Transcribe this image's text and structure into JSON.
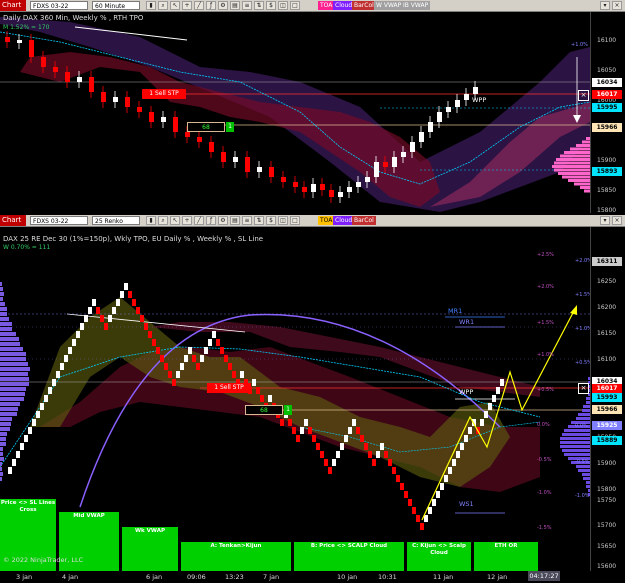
{
  "top_toolbar": {
    "chart_label": "Chart",
    "instrument": "FDXS 03-22",
    "interval": "60 Minute",
    "tags": [
      "TOA",
      "Cloud",
      "BarCol",
      "W VWAP",
      "IB VWAP"
    ]
  },
  "top_pane": {
    "title": "Daily DAX 360 Min, Weekly % , RTH TPO",
    "subtitle": "M 1.52% = 170",
    "price_ticks": [
      "16100",
      "16050",
      "16000",
      "15950",
      "15900",
      "15850",
      "15800"
    ],
    "pct_label": "+1.0%",
    "flags": [
      {
        "text": "16034",
        "bg": "#ffffff",
        "fg": "#000000"
      },
      {
        "text": "16017",
        "bg": "#ff0000",
        "fg": "#ffffff"
      },
      {
        "text": "15995",
        "bg": "#00e5ff",
        "fg": "#000000"
      },
      {
        "text": "15966",
        "bg": "#ffe4b5",
        "fg": "#000000"
      },
      {
        "text": "15893",
        "bg": "#00e5ff",
        "fg": "#000000"
      }
    ],
    "sell_stp": "1 Sell STP",
    "box_value": "68",
    "box_count": "1",
    "wpp": "WPP"
  },
  "bottom_toolbar": {
    "chart_label": "Chart",
    "instrument": "FDXS 03-22",
    "interval": "25 Renko",
    "tags": [
      "TOA",
      "Cloud",
      "BarCol"
    ]
  },
  "bottom_pane": {
    "title": "DAX 25 RE Dec 30 (1%=150p), Wkly TPO, EU Daily % , Weekly % , SL Line",
    "subtitle": "W 0.70% = 111",
    "price_ticks": [
      "16311",
      "16250",
      "16200",
      "16150",
      "16100",
      "16050",
      "16000",
      "15950",
      "15900",
      "15850",
      "15800",
      "15750",
      "15700",
      "15650",
      "15600"
    ],
    "flags": [
      {
        "text": "16311",
        "bg": "#cccccc",
        "fg": "#000000"
      },
      {
        "text": "16034",
        "bg": "#ffffff",
        "fg": "#000000"
      },
      {
        "text": "16017",
        "bg": "#ff0000",
        "fg": "#ffffff"
      },
      {
        "text": "15993",
        "bg": "#00e5ff",
        "fg": "#000000"
      },
      {
        "text": "15966",
        "bg": "#ffe4b5",
        "fg": "#000000"
      },
      {
        "text": "15925",
        "bg": "#8080ff",
        "fg": "#ffffff"
      },
      {
        "text": "15889",
        "bg": "#00e5ff",
        "fg": "#000000"
      }
    ],
    "pct_left": [
      "+2.5%",
      "+2.0%",
      "+1.5%",
      "+1.0%",
      "+0.5%",
      "0.0%",
      "-0.5%",
      "-1.0%",
      "-1.5%"
    ],
    "pct_right": [
      "+2.0%",
      "+1.5%",
      "+1.0%",
      "+0.5%",
      "0.0%",
      "-0.5%",
      "-1.0%"
    ],
    "mr1": "MR1",
    "wr1": "WR1",
    "ws1": "WS1",
    "wpp": "WPP",
    "sell_stp": "1 Sell STP",
    "box_value": "68",
    "box_count": "1",
    "green_boxes": [
      "Price <> SL Lines Cross",
      "Mid VWAP",
      "Wk VWAP",
      "A: Tenkan>Kijun",
      "B: Price <> SCALP Cloud",
      "C: Kijun <> Scalp Cloud",
      "ETH OR"
    ],
    "copyright": "© 2022 NinjaTrader, LLC",
    "x_labels": [
      "3 jan",
      "4 jan",
      "6 jan",
      "09:06",
      "13:23",
      "7 jan",
      "10 jan",
      "10:31",
      "11 jan",
      "12 jan"
    ],
    "time_badge": "04:17:27"
  }
}
